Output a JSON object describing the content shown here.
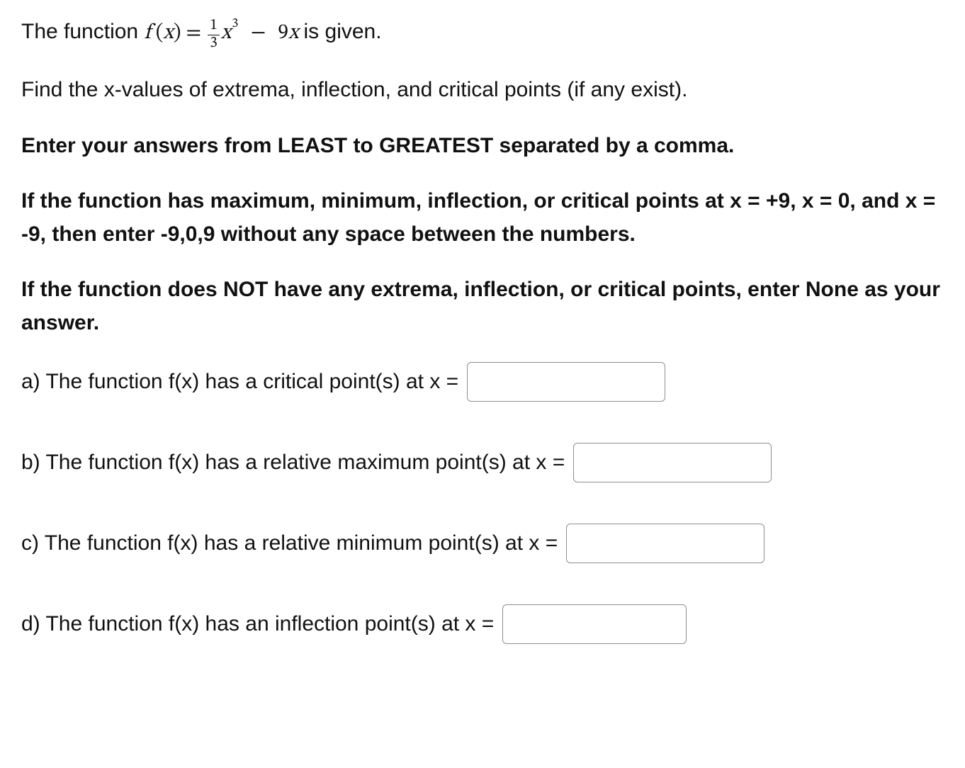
{
  "line1": {
    "prefix": "The function ",
    "eq_fx": "f",
    "eq_open": " (",
    "eq_x": "x",
    "eq_close": ") = ",
    "frac_num": "1",
    "frac_den": "3",
    "eq_x2": "x",
    "eq_cube": "3",
    "minus": " − ",
    "eq_nine": "9",
    "eq_x3": "x",
    "suffix": "    is given."
  },
  "line2": "Find the x-values of extrema, inflection, and critical points (if any exist).",
  "line3": "Enter your answers from LEAST to GREATEST separated by a comma.",
  "line4": "If the function has maximum, minimum, inflection, or critical points at x = +9, x = 0, and x = -9, then enter -9,0,9 without any space between the numbers.",
  "line5": "If the function does NOT have any extrema, inflection, or critical points, enter None as your answer.",
  "qa": {
    "label": "a) The function f(x) has a critical point(s) at x =",
    "value": ""
  },
  "qb": {
    "label": "b) The function f(x) has a relative maximum point(s) at x =",
    "value": ""
  },
  "qc": {
    "label": "c) The function f(x) has a relative minimum point(s) at x =",
    "value": ""
  },
  "qd": {
    "label": "d) The function f(x) has an inflection point(s) at x =",
    "value": ""
  }
}
